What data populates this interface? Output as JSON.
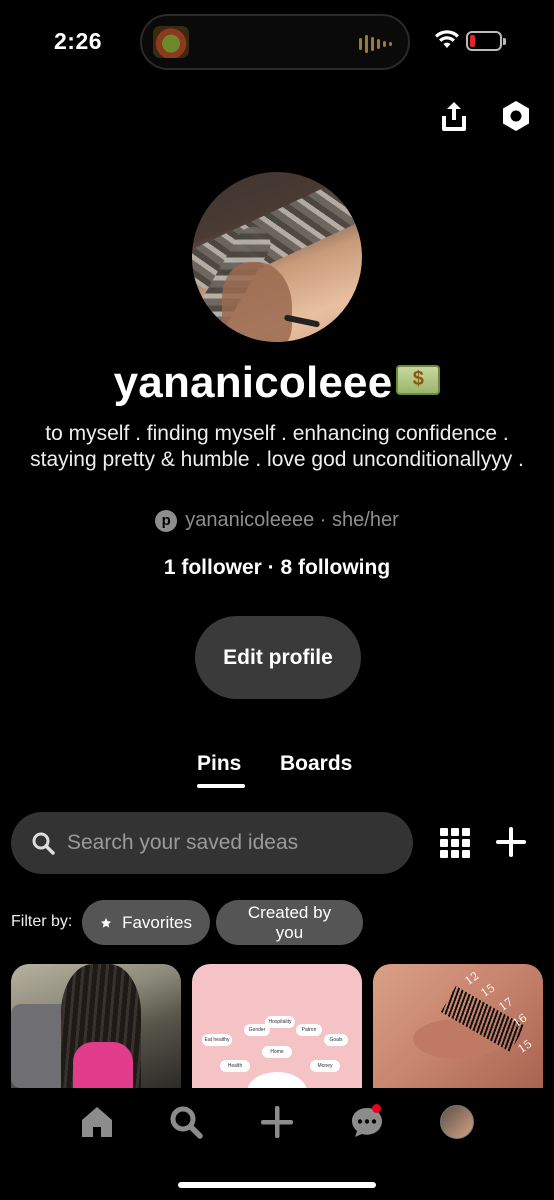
{
  "status_bar": {
    "time": "2:26",
    "battery_color": "#e2262b",
    "icons": [
      "wifi-icon",
      "battery-icon",
      "audio-wave-icon"
    ]
  },
  "top_actions": {
    "icons": [
      "share-icon",
      "settings-icon"
    ]
  },
  "profile": {
    "name": "yananicoleee",
    "name_emoji": "money-with-wings-icon",
    "bio": "to myself .  finding myself .  enhancing confidence .  staying pretty & humble .  love god unconditionallyyy .",
    "handle": "yananicoleeee",
    "pronouns": "she/her",
    "handle_line": "yananicoleeee · she/her",
    "follow_stats": "1 follower · 8 following"
  },
  "edit_button": {
    "label": "Edit profile"
  },
  "tabs": [
    {
      "label": "Pins",
      "active": true
    },
    {
      "label": "Boards",
      "active": false
    }
  ],
  "search": {
    "placeholder": "Search your saved ideas"
  },
  "filters": {
    "label": "Filter by:",
    "chips": [
      {
        "label": "Favorites",
        "icon": "star-icon"
      },
      {
        "label": "Created by you"
      }
    ]
  },
  "pins": {
    "pin_2_labels": [
      "Hospitality",
      "Gender",
      "Patron",
      "Eat healthy",
      "Goals",
      "Home",
      "Health",
      "Money"
    ],
    "pin_3_numbers": [
      "12",
      "15",
      "17",
      "16",
      "15"
    ]
  },
  "bottom_nav": {
    "items": [
      "home-icon",
      "search-icon",
      "create-icon",
      "messages-icon",
      "profile-avatar"
    ],
    "notification_color": "#e60023"
  },
  "theme": {
    "background": "#000000",
    "surface": "#333333",
    "chip": "#555555",
    "muted_text": "#8e8e8e"
  }
}
